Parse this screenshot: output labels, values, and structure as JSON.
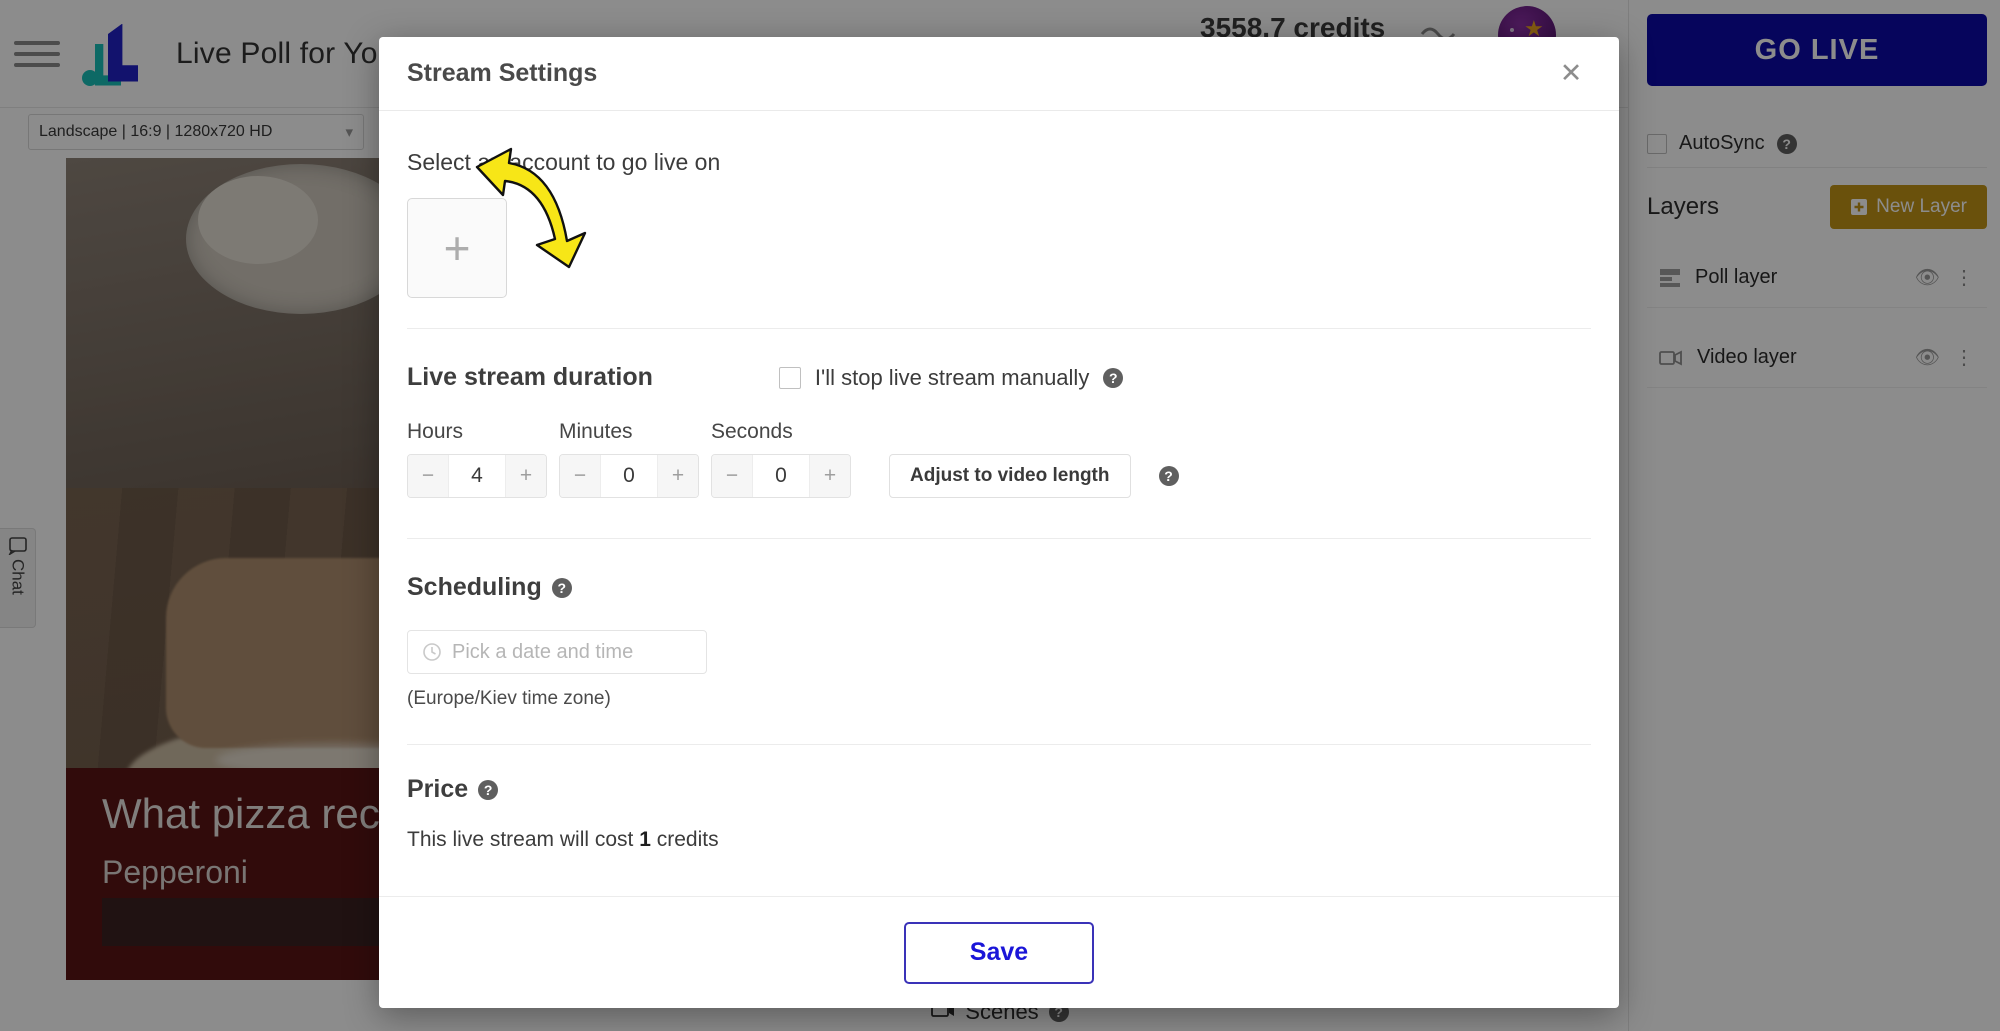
{
  "app": {
    "title": "Live Poll for Youtube",
    "credits": "3558.7 credits",
    "format_select": "Landscape | 16:9 | 1280x720 HD",
    "chat_tab": "Chat",
    "scenes_label": "Scenes"
  },
  "preview": {
    "poll_question": "What pizza recip",
    "poll_answer": "Pepperoni"
  },
  "right_panel": {
    "go_live": "GO LIVE",
    "autosync": "AutoSync",
    "layers_title": "Layers",
    "new_layer": "New Layer",
    "layers": [
      {
        "name": "Poll layer",
        "icon": "poll-layer-icon"
      },
      {
        "name": "Video layer",
        "icon": "video-layer-icon"
      }
    ]
  },
  "modal": {
    "title": "Stream Settings",
    "close_icon": "close-icon",
    "account": {
      "label": "Select an account to go live on",
      "add_tile": "+"
    },
    "duration": {
      "title": "Live stream duration",
      "manual_stop_label": "I'll stop live stream manually",
      "manual_stop_checked": false,
      "fields": [
        {
          "label": "Hours",
          "value": "4"
        },
        {
          "label": "Minutes",
          "value": "0"
        },
        {
          "label": "Seconds",
          "value": "0"
        }
      ],
      "adjust_button": "Adjust to video length",
      "minus": "−",
      "plus": "+"
    },
    "scheduling": {
      "title": "Scheduling",
      "placeholder": "Pick a date and time",
      "value": "",
      "timezone_note": "(Europe/Kiev time zone)"
    },
    "price": {
      "title": "Price",
      "text_before": "This live stream will cost ",
      "amount": "1",
      "text_after": " credits"
    },
    "save_label": "Save"
  },
  "colors": {
    "go_live": "#0c0aa8",
    "new_layer": "#c29416",
    "save_text": "#1a15d8",
    "arrow": "#f7e617",
    "poll_card": "#5a1414"
  }
}
